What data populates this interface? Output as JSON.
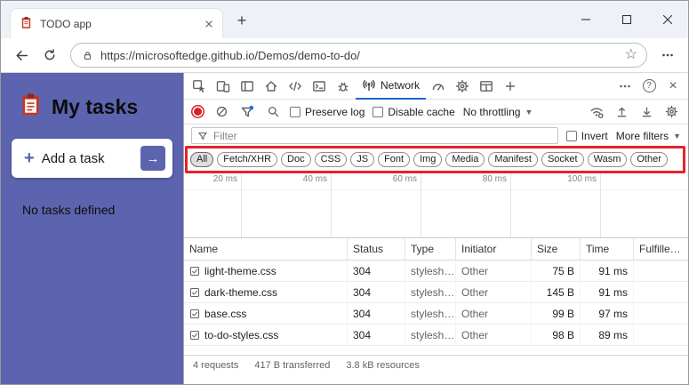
{
  "browser": {
    "tab_title": "TODO app",
    "url": "https://microsoftedge.github.io/Demos/demo-to-do/"
  },
  "app": {
    "title": "My tasks",
    "add_task_label": "Add a task",
    "empty_message": "No tasks defined"
  },
  "devtools": {
    "network_tab_label": "Network",
    "toolbar": {
      "preserve_log": "Preserve log",
      "disable_cache": "Disable cache",
      "throttling": "No throttling"
    },
    "filter_bar": {
      "placeholder": "Filter",
      "invert": "Invert",
      "more_filters": "More filters"
    },
    "type_filters": [
      "All",
      "Fetch/XHR",
      "Doc",
      "CSS",
      "JS",
      "Font",
      "Img",
      "Media",
      "Manifest",
      "Socket",
      "Wasm",
      "Other"
    ],
    "selected_type_filter": "All",
    "timeline_ticks": [
      "20 ms",
      "40 ms",
      "60 ms",
      "80 ms",
      "100 ms"
    ],
    "table": {
      "columns": [
        "Name",
        "Status",
        "Type",
        "Initiator",
        "Size",
        "Time",
        "Fulfille…"
      ],
      "rows": [
        {
          "name": "light-theme.css",
          "status": "304",
          "type": "stylesh…",
          "initiator": "Other",
          "size": "75 B",
          "time": "91 ms"
        },
        {
          "name": "dark-theme.css",
          "status": "304",
          "type": "stylesh…",
          "initiator": "Other",
          "size": "145 B",
          "time": "91 ms"
        },
        {
          "name": "base.css",
          "status": "304",
          "type": "stylesh…",
          "initiator": "Other",
          "size": "99 B",
          "time": "97 ms"
        },
        {
          "name": "to-do-styles.css",
          "status": "304",
          "type": "stylesh…",
          "initiator": "Other",
          "size": "98 B",
          "time": "89 ms"
        }
      ]
    },
    "summary": {
      "requests": "4 requests",
      "transferred": "417 B transferred",
      "resources": "3.8 kB resources"
    }
  },
  "colors": {
    "sidebar_purple": "#5d64af",
    "selected_tab_underline": "#1967d2",
    "annotation_red": "#e8212b",
    "record_red": "#d6222a"
  }
}
